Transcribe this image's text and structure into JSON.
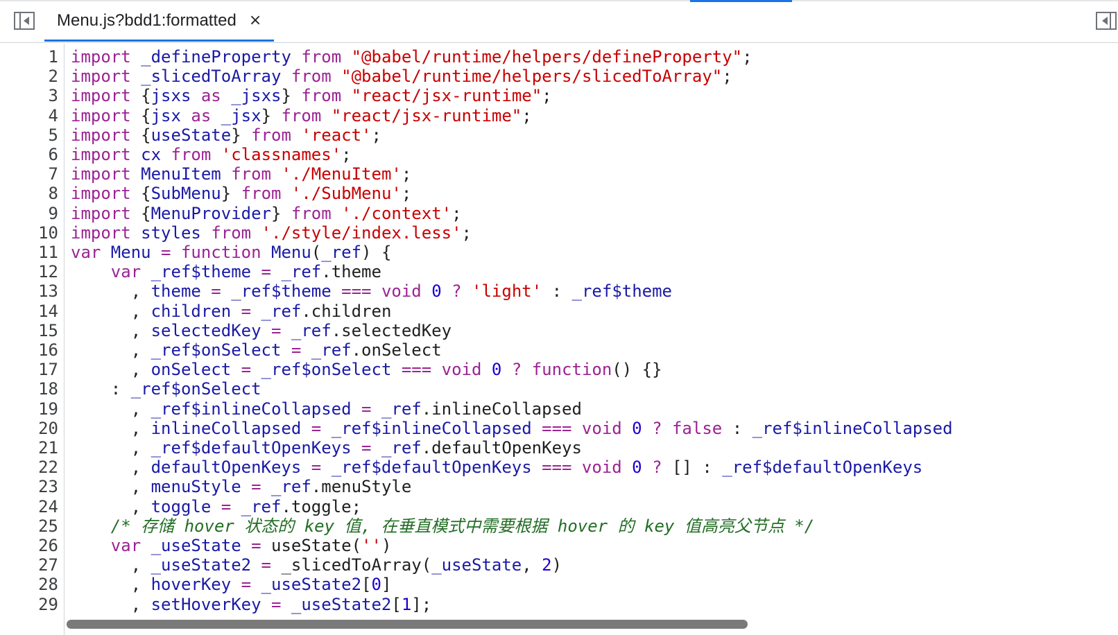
{
  "tab": {
    "title": "Menu.js?bdd1:formatted",
    "close": "×"
  },
  "icons": {
    "left_toggle": "sidebar-left-icon",
    "right_toggle": "sidebar-right-icon"
  },
  "colors": {
    "keyword": "#9b2393",
    "identifier": "#1a1aa6",
    "string": "#c80000",
    "comment": "#236e25",
    "accent": "#1a73e8"
  },
  "code_lines": [
    [
      [
        "kw",
        "import "
      ],
      [
        "var",
        "_defineProperty "
      ],
      [
        "kw",
        "from "
      ],
      [
        "str",
        "\"@babel/runtime/helpers/defineProperty\""
      ],
      [
        "pl",
        ";"
      ]
    ],
    [
      [
        "kw",
        "import "
      ],
      [
        "var",
        "_slicedToArray "
      ],
      [
        "kw",
        "from "
      ],
      [
        "str",
        "\"@babel/runtime/helpers/slicedToArray\""
      ],
      [
        "pl",
        ";"
      ]
    ],
    [
      [
        "kw",
        "import "
      ],
      [
        "pl",
        "{"
      ],
      [
        "var",
        "jsxs "
      ],
      [
        "kw",
        "as "
      ],
      [
        "var",
        "_jsxs"
      ],
      [
        "pl",
        "} "
      ],
      [
        "kw",
        "from "
      ],
      [
        "str",
        "\"react/jsx-runtime\""
      ],
      [
        "pl",
        ";"
      ]
    ],
    [
      [
        "kw",
        "import "
      ],
      [
        "pl",
        "{"
      ],
      [
        "var",
        "jsx "
      ],
      [
        "kw",
        "as "
      ],
      [
        "var",
        "_jsx"
      ],
      [
        "pl",
        "} "
      ],
      [
        "kw",
        "from "
      ],
      [
        "str",
        "\"react/jsx-runtime\""
      ],
      [
        "pl",
        ";"
      ]
    ],
    [
      [
        "kw",
        "import "
      ],
      [
        "pl",
        "{"
      ],
      [
        "var",
        "useState"
      ],
      [
        "pl",
        "} "
      ],
      [
        "kw",
        "from "
      ],
      [
        "str",
        "'react'"
      ],
      [
        "pl",
        ";"
      ]
    ],
    [
      [
        "kw",
        "import "
      ],
      [
        "var",
        "cx "
      ],
      [
        "kw",
        "from "
      ],
      [
        "str",
        "'classnames'"
      ],
      [
        "pl",
        ";"
      ]
    ],
    [
      [
        "kw",
        "import "
      ],
      [
        "var",
        "MenuItem "
      ],
      [
        "kw",
        "from "
      ],
      [
        "str",
        "'./MenuItem'"
      ],
      [
        "pl",
        ";"
      ]
    ],
    [
      [
        "kw",
        "import "
      ],
      [
        "pl",
        "{"
      ],
      [
        "var",
        "SubMenu"
      ],
      [
        "pl",
        "} "
      ],
      [
        "kw",
        "from "
      ],
      [
        "str",
        "'./SubMenu'"
      ],
      [
        "pl",
        ";"
      ]
    ],
    [
      [
        "kw",
        "import "
      ],
      [
        "pl",
        "{"
      ],
      [
        "var",
        "MenuProvider"
      ],
      [
        "pl",
        "} "
      ],
      [
        "kw",
        "from "
      ],
      [
        "str",
        "'./context'"
      ],
      [
        "pl",
        ";"
      ]
    ],
    [
      [
        "kw",
        "import "
      ],
      [
        "var",
        "styles "
      ],
      [
        "kw",
        "from "
      ],
      [
        "str",
        "'./style/index.less'"
      ],
      [
        "pl",
        ";"
      ]
    ],
    [
      [
        "kw",
        "var "
      ],
      [
        "var",
        "Menu "
      ],
      [
        "op",
        "= "
      ],
      [
        "kw",
        "function "
      ],
      [
        "var",
        "Menu"
      ],
      [
        "pl",
        "("
      ],
      [
        "var",
        "_ref"
      ],
      [
        "pl",
        ") {"
      ]
    ],
    [
      [
        "pl",
        "    "
      ],
      [
        "kw",
        "var "
      ],
      [
        "var",
        "_ref$theme "
      ],
      [
        "op",
        "= "
      ],
      [
        "var",
        "_ref"
      ],
      [
        "pl",
        ".theme"
      ]
    ],
    [
      [
        "pl",
        "      , "
      ],
      [
        "var",
        "theme "
      ],
      [
        "op",
        "= "
      ],
      [
        "var",
        "_ref$theme "
      ],
      [
        "op",
        "=== "
      ],
      [
        "kw",
        "void "
      ],
      [
        "num",
        "0 "
      ],
      [
        "op",
        "? "
      ],
      [
        "str",
        "'light' "
      ],
      [
        "pl",
        ": "
      ],
      [
        "var",
        "_ref$theme"
      ]
    ],
    [
      [
        "pl",
        "      , "
      ],
      [
        "var",
        "children "
      ],
      [
        "op",
        "= "
      ],
      [
        "var",
        "_ref"
      ],
      [
        "pl",
        ".children"
      ]
    ],
    [
      [
        "pl",
        "      , "
      ],
      [
        "var",
        "selectedKey "
      ],
      [
        "op",
        "= "
      ],
      [
        "var",
        "_ref"
      ],
      [
        "pl",
        ".selectedKey"
      ]
    ],
    [
      [
        "pl",
        "      , "
      ],
      [
        "var",
        "_ref$onSelect "
      ],
      [
        "op",
        "= "
      ],
      [
        "var",
        "_ref"
      ],
      [
        "pl",
        ".onSelect"
      ]
    ],
    [
      [
        "pl",
        "      , "
      ],
      [
        "var",
        "onSelect "
      ],
      [
        "op",
        "= "
      ],
      [
        "var",
        "_ref$onSelect "
      ],
      [
        "op",
        "=== "
      ],
      [
        "kw",
        "void "
      ],
      [
        "num",
        "0 "
      ],
      [
        "op",
        "? "
      ],
      [
        "kw",
        "function"
      ],
      [
        "pl",
        "() {}"
      ]
    ],
    [
      [
        "pl",
        "    : "
      ],
      [
        "var",
        "_ref$onSelect"
      ]
    ],
    [
      [
        "pl",
        "      , "
      ],
      [
        "var",
        "_ref$inlineCollapsed "
      ],
      [
        "op",
        "= "
      ],
      [
        "var",
        "_ref"
      ],
      [
        "pl",
        ".inlineCollapsed"
      ]
    ],
    [
      [
        "pl",
        "      , "
      ],
      [
        "var",
        "inlineCollapsed "
      ],
      [
        "op",
        "= "
      ],
      [
        "var",
        "_ref$inlineCollapsed "
      ],
      [
        "op",
        "=== "
      ],
      [
        "kw",
        "void "
      ],
      [
        "num",
        "0 "
      ],
      [
        "op",
        "? "
      ],
      [
        "kw",
        "false "
      ],
      [
        "pl",
        ": "
      ],
      [
        "var",
        "_ref$inlineCollapsed"
      ]
    ],
    [
      [
        "pl",
        "      , "
      ],
      [
        "var",
        "_ref$defaultOpenKeys "
      ],
      [
        "op",
        "= "
      ],
      [
        "var",
        "_ref"
      ],
      [
        "pl",
        ".defaultOpenKeys"
      ]
    ],
    [
      [
        "pl",
        "      , "
      ],
      [
        "var",
        "defaultOpenKeys "
      ],
      [
        "op",
        "= "
      ],
      [
        "var",
        "_ref$defaultOpenKeys "
      ],
      [
        "op",
        "=== "
      ],
      [
        "kw",
        "void "
      ],
      [
        "num",
        "0 "
      ],
      [
        "op",
        "? "
      ],
      [
        "pl",
        "[] : "
      ],
      [
        "var",
        "_ref$defaultOpenKeys"
      ]
    ],
    [
      [
        "pl",
        "      , "
      ],
      [
        "var",
        "menuStyle "
      ],
      [
        "op",
        "= "
      ],
      [
        "var",
        "_ref"
      ],
      [
        "pl",
        ".menuStyle"
      ]
    ],
    [
      [
        "pl",
        "      , "
      ],
      [
        "var",
        "toggle "
      ],
      [
        "op",
        "= "
      ],
      [
        "var",
        "_ref"
      ],
      [
        "pl",
        ".toggle;"
      ]
    ],
    [
      [
        "pl",
        "    "
      ],
      [
        "cm",
        "/* 存储 hover 状态的 key 值, 在垂直模式中需要根据 hover 的 key 值高亮父节点 */"
      ]
    ],
    [
      [
        "pl",
        "    "
      ],
      [
        "kw",
        "var "
      ],
      [
        "var",
        "_useState "
      ],
      [
        "op",
        "= "
      ],
      [
        "pl",
        "useState("
      ],
      [
        "str",
        "''"
      ],
      [
        "pl",
        ")"
      ]
    ],
    [
      [
        "pl",
        "      , "
      ],
      [
        "var",
        "_useState2 "
      ],
      [
        "op",
        "= "
      ],
      [
        "pl",
        "_slicedToArray("
      ],
      [
        "var",
        "_useState"
      ],
      [
        "pl",
        ", "
      ],
      [
        "num",
        "2"
      ],
      [
        "pl",
        ")"
      ]
    ],
    [
      [
        "pl",
        "      , "
      ],
      [
        "var",
        "hoverKey "
      ],
      [
        "op",
        "= "
      ],
      [
        "var",
        "_useState2"
      ],
      [
        "pl",
        "["
      ],
      [
        "num",
        "0"
      ],
      [
        "pl",
        "]"
      ]
    ],
    [
      [
        "pl",
        "      , "
      ],
      [
        "var",
        "setHoverKey "
      ],
      [
        "op",
        "= "
      ],
      [
        "var",
        "_useState2"
      ],
      [
        "pl",
        "["
      ],
      [
        "num",
        "1"
      ],
      [
        "pl",
        "];"
      ]
    ]
  ],
  "line_numbers": [
    "1",
    "2",
    "3",
    "4",
    "5",
    "6",
    "7",
    "8",
    "9",
    "10",
    "11",
    "12",
    "13",
    "14",
    "15",
    "16",
    "17",
    "18",
    "19",
    "20",
    "21",
    "22",
    "23",
    "24",
    "25",
    "26",
    "27",
    "28",
    "29"
  ]
}
